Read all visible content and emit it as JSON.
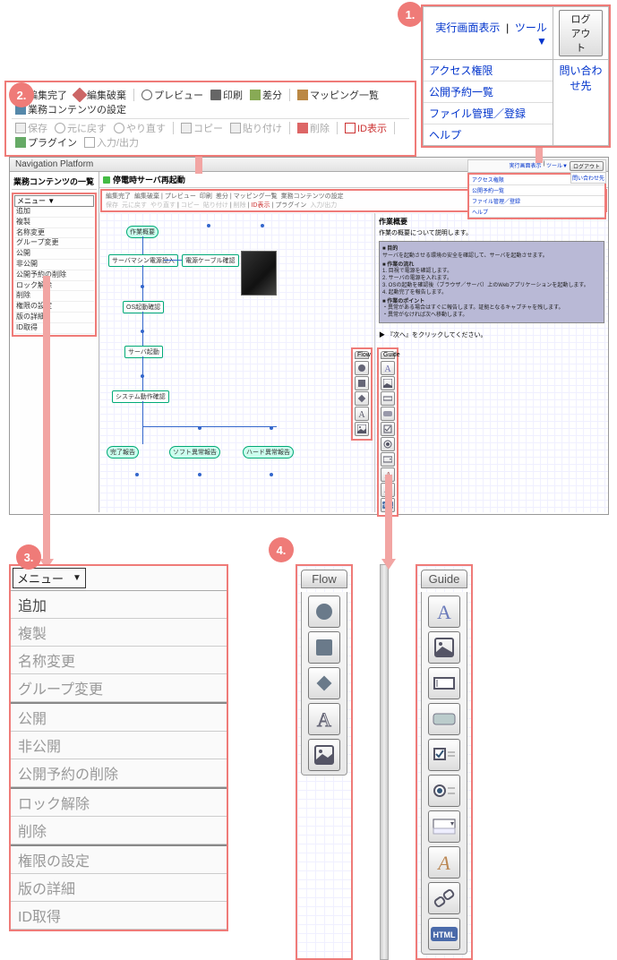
{
  "header_menu": {
    "exec_view": "実行画面表示",
    "tools": "ツール▼",
    "logout": "ログアウト",
    "contact": "問い合わせ先",
    "links": [
      "アクセス権限",
      "公開予約一覧",
      "ファイル管理／登録",
      "ヘルプ"
    ]
  },
  "toolbar": {
    "row1": {
      "edit_done": "編集完了",
      "edit_discard": "編集破棄",
      "preview": "プレビュー",
      "print": "印刷",
      "diff": "差分",
      "mapping_list": "マッピング一覧",
      "biz_settings": "業務コンテンツの設定"
    },
    "row2": {
      "save": "保存",
      "undo": "元に戻す",
      "redo": "やり直す",
      "copy": "コピー",
      "paste": "貼り付け",
      "delete": "削除",
      "id_view": "ID表示",
      "plugin": "プラグイン",
      "io": "入力/出力"
    }
  },
  "app": {
    "title": "Navigation Platform",
    "sidebar_title": "業務コンテンツの一覧",
    "menu_label": "メニュー ▼",
    "menu_items": [
      "追加",
      "複製",
      "名称変更",
      "グループ変更",
      "公開",
      "非公開",
      "公開予約の削除",
      "ロック解除",
      "削除",
      "権限の設定",
      "版の詳細",
      "ID取得"
    ],
    "content_title": "停電時サーバ再起動",
    "flow": {
      "start": "作業概要",
      "n1": "サーバマシン電源投入",
      "n2": "電源ケーブル確認",
      "n3": "OS起動確認",
      "n4": "サーバ起動",
      "n5": "システム動作確認",
      "e1": "完了報告",
      "e2": "ソフト異常報告",
      "e3": "ハード異常報告"
    },
    "guide": {
      "title": "作業概要",
      "desc": "作業の概要について説明します。",
      "sec1_h": "■ 目的",
      "sec1": "サーバを起動させる環境の安全を確認して、サーバを起動させます。",
      "sec2_h": "■ 作業の流れ",
      "sec2_1": "1. 目視で電源を確認します。",
      "sec2_2": "2. サーバの電源を入れます。",
      "sec2_3": "3. OSの起動を確認後（ブラウザ／サーバ）上のWebアプリケーションを起動します。",
      "sec2_4": "4. 起動完了を報告します。",
      "sec3_h": "■ 作業のポイント",
      "sec3_1": "・異常がある場合はすぐに報告します。証拠となるキャプチャを残します。",
      "sec3_2": "・異常がなければ次へ移動します。",
      "next": "『次へ』をクリックしてください。"
    },
    "palette_flow_title": "Flow",
    "palette_guide_title": "Guide"
  },
  "callout3": {
    "menu_label": "メニュー",
    "items": [
      "追加",
      "複製",
      "名称変更",
      "グループ変更",
      "公開",
      "非公開",
      "公開予約の削除",
      "ロック解除",
      "削除",
      "権限の設定",
      "版の詳細",
      "ID取得"
    ]
  },
  "callouts": {
    "c1": "1.",
    "c2": "2.",
    "c3": "3.",
    "c4": "4."
  },
  "icons": {
    "flow": [
      "circle",
      "square",
      "diamond",
      "text-a",
      "image"
    ],
    "guide": [
      "text-a",
      "image",
      "textbox",
      "button",
      "checkbox",
      "radio",
      "dropdown",
      "text-style",
      "link",
      "html"
    ]
  }
}
